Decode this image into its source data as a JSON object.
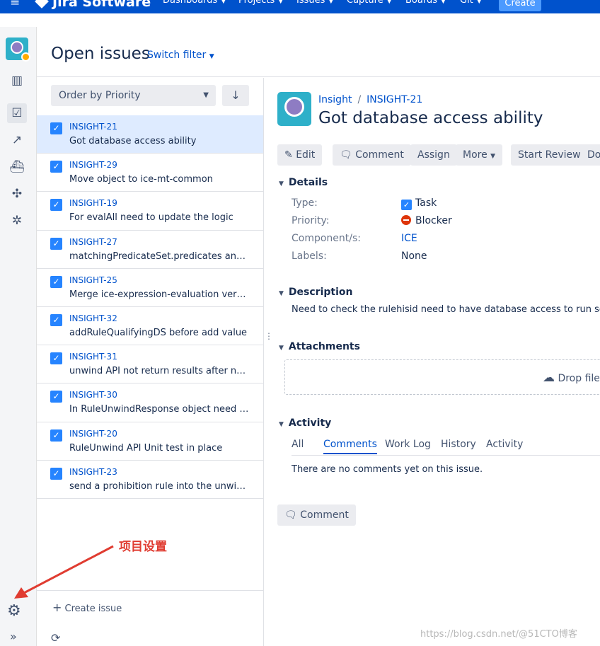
{
  "topbar": {
    "logo": "Jira Software",
    "nav": [
      "Dashboards",
      "Projects",
      "Issues",
      "Capture",
      "Boards",
      "Git"
    ],
    "create": "Create"
  },
  "header": {
    "title": "Open issues",
    "switch_filter": "Switch filter"
  },
  "list": {
    "order_by": "Order by Priority",
    "items": [
      {
        "key": "INSIGHT-21",
        "summary": "Got database access ability"
      },
      {
        "key": "INSIGHT-29",
        "summary": "Move object to ice-mt-common"
      },
      {
        "key": "INSIGHT-19",
        "summary": "For evalAll need to update the logic"
      },
      {
        "key": "INSIGHT-27",
        "summary": "matchingPredicateSet.predicates and m..."
      },
      {
        "key": "INSIGHT-25",
        "summary": "Merge ice-expression-evaluation versio..."
      },
      {
        "key": "INSIGHT-32",
        "summary": "addRuleQualifyingDS before add value"
      },
      {
        "key": "INSIGHT-31",
        "summary": "unwind API not return results after new..."
      },
      {
        "key": "INSIGHT-30",
        "summary": "In RuleUnwindResponse object need to ..."
      },
      {
        "key": "INSIGHT-20",
        "summary": "RuleUnwind API Unit test in place"
      },
      {
        "key": "INSIGHT-23",
        "summary": "send a prohibition rule into the unwind ..."
      }
    ],
    "create_issue": "Create issue"
  },
  "detail": {
    "project": "Insight",
    "key": "INSIGHT-21",
    "title": "Got database access ability",
    "toolbar": {
      "edit": "Edit",
      "comment": "Comment",
      "assign": "Assign",
      "more": "More",
      "start_review": "Start Review",
      "done": "Do"
    },
    "details": {
      "heading": "Details",
      "type_label": "Type:",
      "type_value": "Task",
      "priority_label": "Priority:",
      "priority_value": "Blocker",
      "components_label": "Component/s:",
      "components_value": "ICE",
      "labels_label": "Labels:",
      "labels_value": "None"
    },
    "description": {
      "heading": "Description",
      "text": "Need to check the rulehisid need to have database access to run sql in c"
    },
    "attachments": {
      "heading": "Attachments",
      "drop": "Drop file"
    },
    "activity": {
      "heading": "Activity",
      "tabs": [
        "All",
        "Comments",
        "Work Log",
        "History",
        "Activity"
      ],
      "empty": "There are no comments yet on this issue.",
      "comment_button": "Comment"
    }
  },
  "annotation": "项目设置",
  "watermark": "https://blog.csdn.net/@51CTO博客"
}
